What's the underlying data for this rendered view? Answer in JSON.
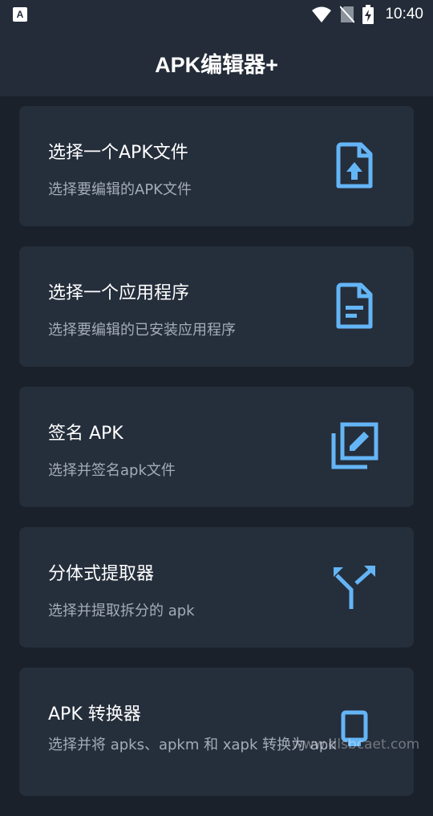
{
  "status_bar": {
    "app_icon_letter": "A",
    "time": "10:40"
  },
  "app_bar": {
    "title": "APK编辑器+"
  },
  "cards": [
    {
      "title": "选择一个APK文件",
      "subtitle": "选择要编辑的APK文件",
      "icon": "file-upload-icon"
    },
    {
      "title": "选择一个应用程序",
      "subtitle": "选择要编辑的已安装应用程序",
      "icon": "document-icon"
    },
    {
      "title": "签名 APK",
      "subtitle": "选择并签名apk文件",
      "icon": "sign-edit-icon"
    },
    {
      "title": "分体式提取器",
      "subtitle": "选择并提取拆分的 apk",
      "icon": "split-arrows-icon"
    },
    {
      "title": "APK 转换器",
      "subtitle": "选择并将 apks、apkm 和 xapk 转换为 apk",
      "icon": "convert-icon"
    }
  ],
  "watermark": "www.dlsbcaet.com",
  "colors": {
    "background": "#1a212b",
    "bar": "#232c38",
    "card": "#252e3b",
    "accent": "#64b5f6",
    "subtitle": "#a3acb8"
  }
}
